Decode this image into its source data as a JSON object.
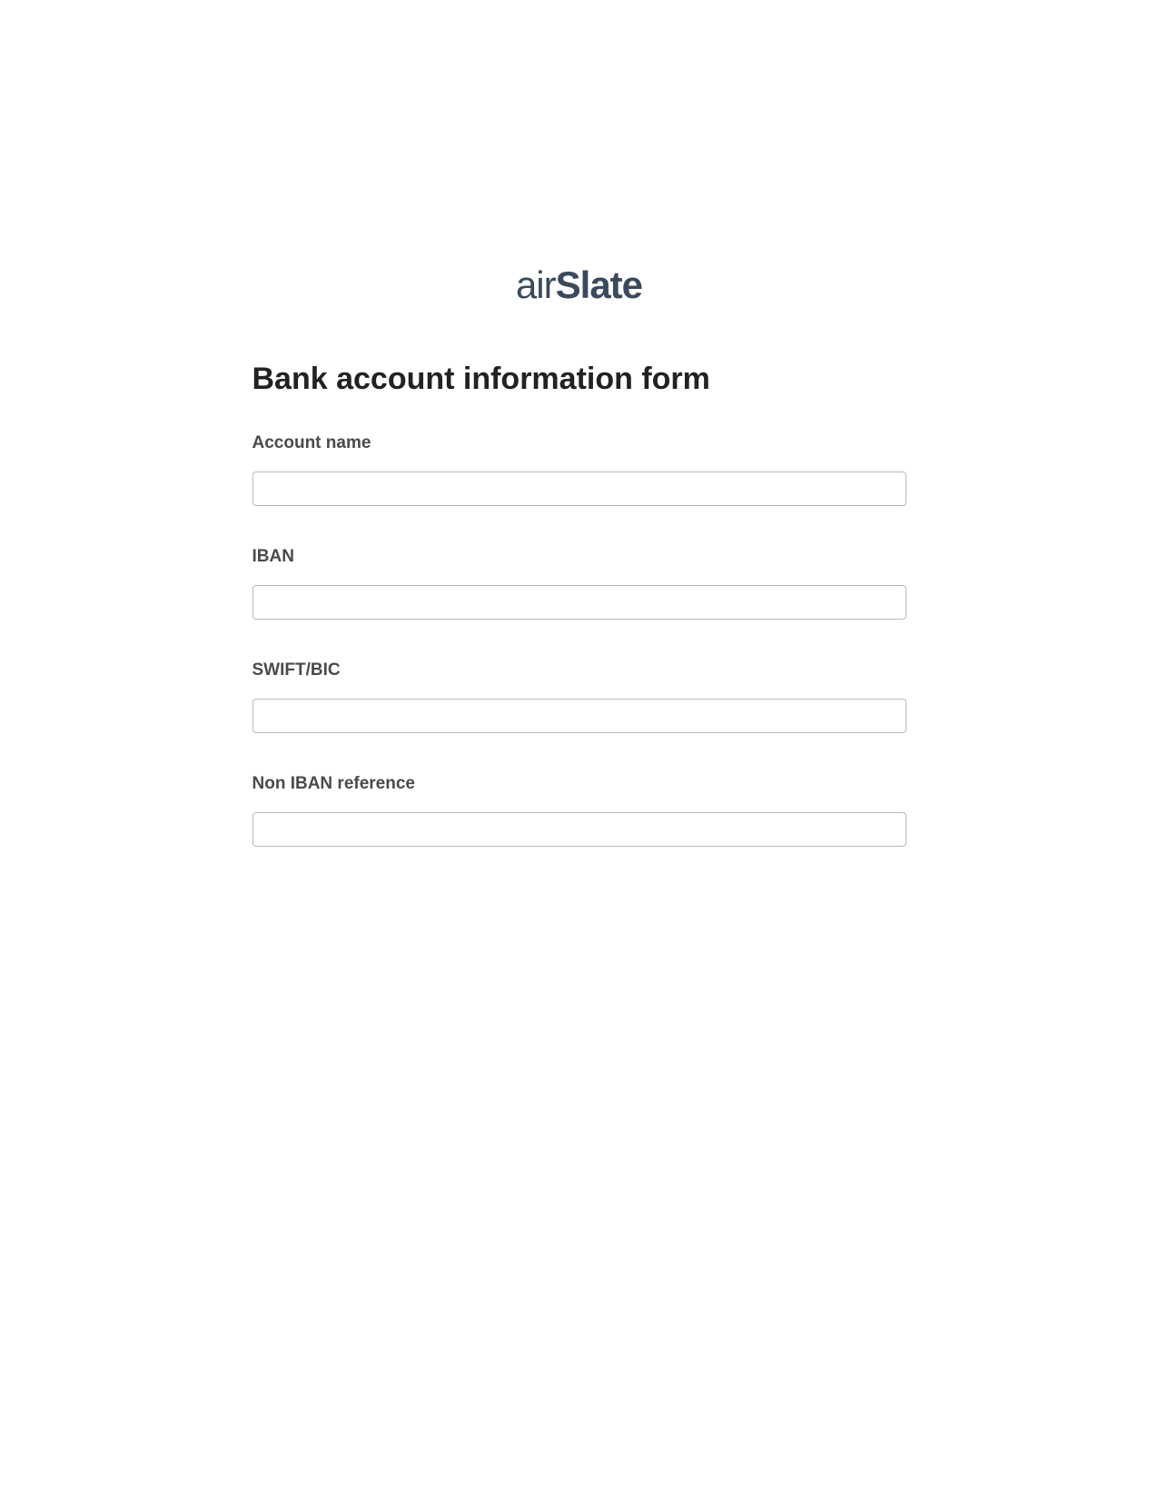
{
  "logo": {
    "prefix": "air",
    "suffix": "Slate"
  },
  "form": {
    "title": "Bank account information form",
    "fields": [
      {
        "label": "Account name",
        "value": ""
      },
      {
        "label": "IBAN",
        "value": ""
      },
      {
        "label": "SWIFT/BIC",
        "value": ""
      },
      {
        "label": "Non IBAN reference",
        "value": ""
      }
    ]
  }
}
